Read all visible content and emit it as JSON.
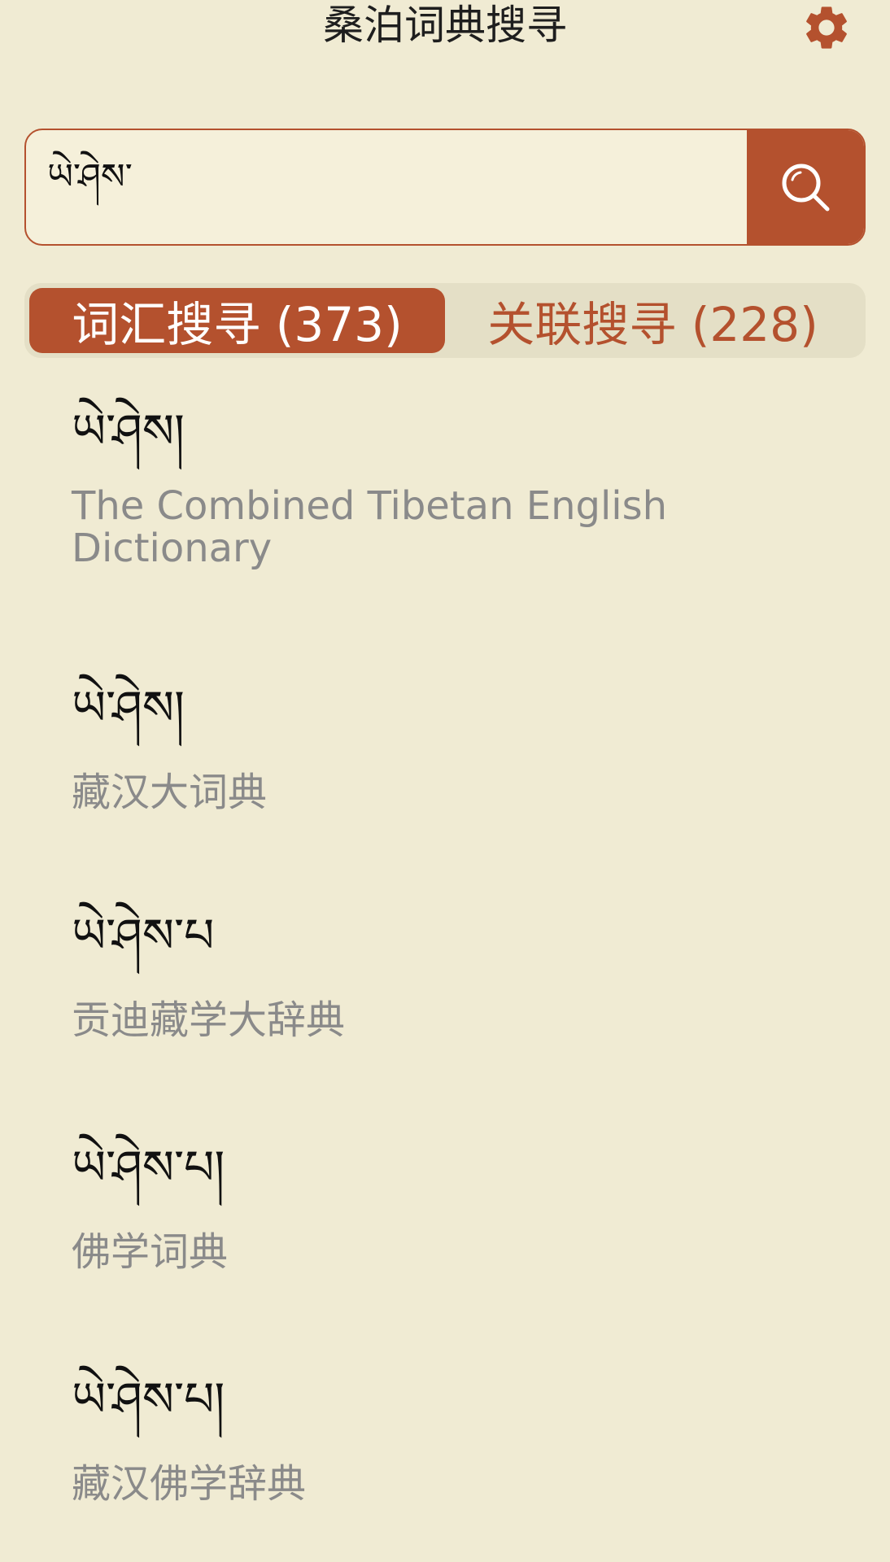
{
  "header": {
    "title": "桑泊词典搜寻",
    "settings_icon": "gear-icon"
  },
  "search": {
    "value": "ཡེ་ཤེས་",
    "button_icon": "search-icon"
  },
  "tabs": [
    {
      "label": "词汇搜寻 (373)",
      "active": true
    },
    {
      "label": "关联搜寻 (228)",
      "active": false
    }
  ],
  "results": [
    {
      "term": "ཡེ་ཤེས།",
      "source": "The Combined Tibetan English Dictionary"
    },
    {
      "term": "ཡེ་ཤེས།",
      "source": "藏汉大词典"
    },
    {
      "term": "ཡེ་ཤེས་པ",
      "source": "贡迪藏学大辞典"
    },
    {
      "term": "ཡེ་ཤེས་པ།",
      "source": "佛学词典"
    },
    {
      "term": "ཡེ་ཤེས་པ།",
      "source": "藏汉佛学辞典"
    }
  ],
  "colors": {
    "accent": "#b4512e",
    "background": "#f0ebd3",
    "muted": "#8a8a8a"
  }
}
